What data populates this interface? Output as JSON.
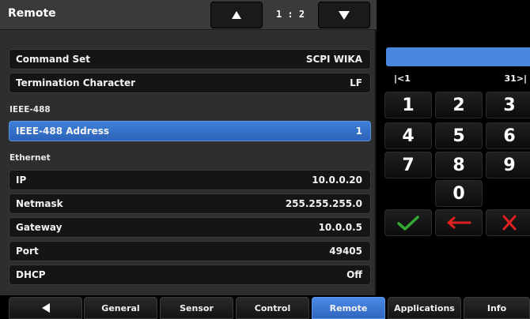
{
  "header": {
    "title": "Remote",
    "page_indicator": "1 : 2"
  },
  "settings": {
    "command_set": {
      "label": "Command Set",
      "value": "SCPI WIKA"
    },
    "termination": {
      "label": "Termination Character",
      "value": "LF"
    },
    "ieee_section": "IEEE-488",
    "ieee_address": {
      "label": "IEEE-488 Address",
      "value": "1"
    },
    "ethernet_section": "Ethernet",
    "ip": {
      "label": "IP",
      "value": "10.0.0.20"
    },
    "netmask": {
      "label": "Netmask",
      "value": "255.255.255.0"
    },
    "gateway": {
      "label": "Gateway",
      "value": "10.0.0.5"
    },
    "port": {
      "label": "Port",
      "value": "49405"
    },
    "dhcp": {
      "label": "DHCP",
      "value": "Off"
    }
  },
  "keypad": {
    "range_min": "|<1",
    "range_max": "31>|",
    "digits": [
      "1",
      "2",
      "3",
      "4",
      "5",
      "6",
      "7",
      "8",
      "9",
      "0"
    ],
    "accept_icon": "check-icon",
    "backspace_icon": "backspace-arrow-icon",
    "cancel_icon": "cancel-x-icon"
  },
  "tabs": {
    "back_icon": "back-arrow-icon",
    "general": "General",
    "sensor": "Sensor",
    "control": "Control",
    "remote": "Remote",
    "applications": "Applications",
    "info": "Info"
  },
  "colors": {
    "selected_accent": "#3f7fd8",
    "accept_green": "#33aa33",
    "cancel_red": "#e02020"
  }
}
